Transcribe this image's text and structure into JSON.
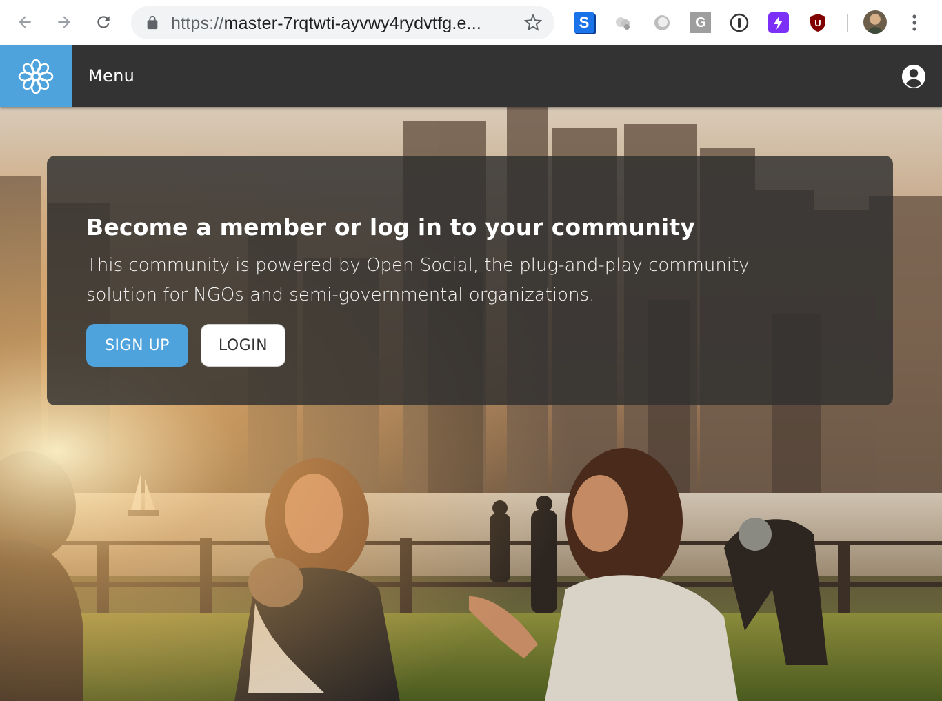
{
  "browser": {
    "url_scheme": "https://",
    "url_rest": "master-7rqtwti-ayvwy4rydvtfg.e...",
    "extensions": [
      {
        "name": "s-extension-icon",
        "label": "S"
      },
      {
        "name": "g-extension-icon",
        "label": "G"
      },
      {
        "name": "ublock-extension-icon",
        "label": "U"
      }
    ]
  },
  "header": {
    "menu_label": "Menu"
  },
  "hero": {
    "title": "Become a member or log in to your community",
    "description": "This community is powered by Open Social, the plug-and-play community solution for NGOs and semi-governmental organizations.",
    "signup_label": "SIGN UP",
    "login_label": "LOGIN"
  },
  "colors": {
    "brand_blue": "#4fa3dd",
    "header_dark": "#333333"
  }
}
